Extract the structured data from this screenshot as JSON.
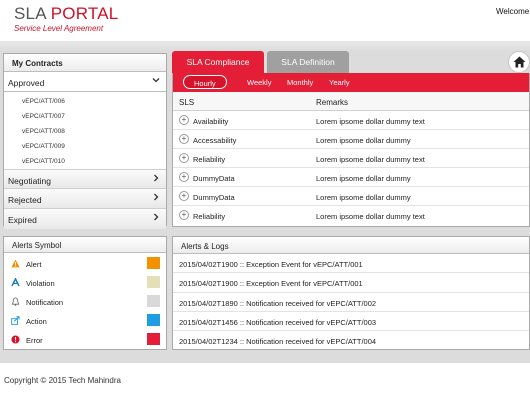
{
  "header": {
    "logo_sla": "SLA",
    "logo_portal": "PORTAL",
    "subtitle": "Service Level Agreement",
    "welcome": "Welcome !"
  },
  "contracts": {
    "title": "My Contracts",
    "approved_label": "Approved",
    "approved_items": [
      "vEPC/ATT/006",
      "vEPC/ATT/007",
      "vEPC/ATT/008",
      "vEPC/ATT/009",
      "vEPC/ATT/010"
    ],
    "sections": [
      "Negotiating",
      "Rejected",
      "Expired"
    ]
  },
  "alerts_symbol": {
    "title": "Alerts Symbol",
    "items": [
      {
        "label": "Alert",
        "icon": "warning-triangle-icon",
        "color": "#f39200"
      },
      {
        "label": "Violation",
        "icon": "violation-icon",
        "color": "#e3dfb6"
      },
      {
        "label": "Notification",
        "icon": "bell-icon",
        "color": "#d9d9d9"
      },
      {
        "label": "Action",
        "icon": "action-share-icon",
        "color": "#1e9de3"
      },
      {
        "label": "Error",
        "icon": "error-circle-icon",
        "color": "#e41e38"
      }
    ]
  },
  "tabs": {
    "compliance": "SLA Compliance",
    "definition": "SLA Definition",
    "home_icon": "home-icon"
  },
  "subtabs": [
    "Hourly",
    "Weekly",
    "Monthly",
    "Yearly"
  ],
  "sls_table": {
    "col_sls": "SLS",
    "col_remarks": "Remarks",
    "rows": [
      {
        "name": "Availability",
        "remark": "Lorem ipsome dollar dummy text"
      },
      {
        "name": "Accessability",
        "remark": "Lorem ipsome dollar dummy"
      },
      {
        "name": "Reliability",
        "remark": "Lorem ipsome dollar dummy text"
      },
      {
        "name": "DummyData",
        "remark": "Lorem ipsome dollar dummy"
      },
      {
        "name": "DummyData",
        "remark": "Lorem ipsome dollar dummy"
      },
      {
        "name": "Reliability",
        "remark": "Lorem ipsome dollar dummy text"
      }
    ]
  },
  "logs": {
    "title": "Alerts & Logs",
    "entries": [
      "2015/04/02T1900 :: Exception Event for vEPC/ATT/001",
      "2015/04/02T1900 :: Exception Event for vEPC/ATT/001",
      "2015/04/02T1890 :: Notification received for vEPC/ATT/002",
      "2015/04/02T1456 :: Notification received for vEPC/ATT/003",
      "2015/04/02T1234 :: Notification received for vEPC/ATT/004"
    ]
  },
  "footer": {
    "copyright": "Copyright © 2015 Tech Mahindra"
  }
}
